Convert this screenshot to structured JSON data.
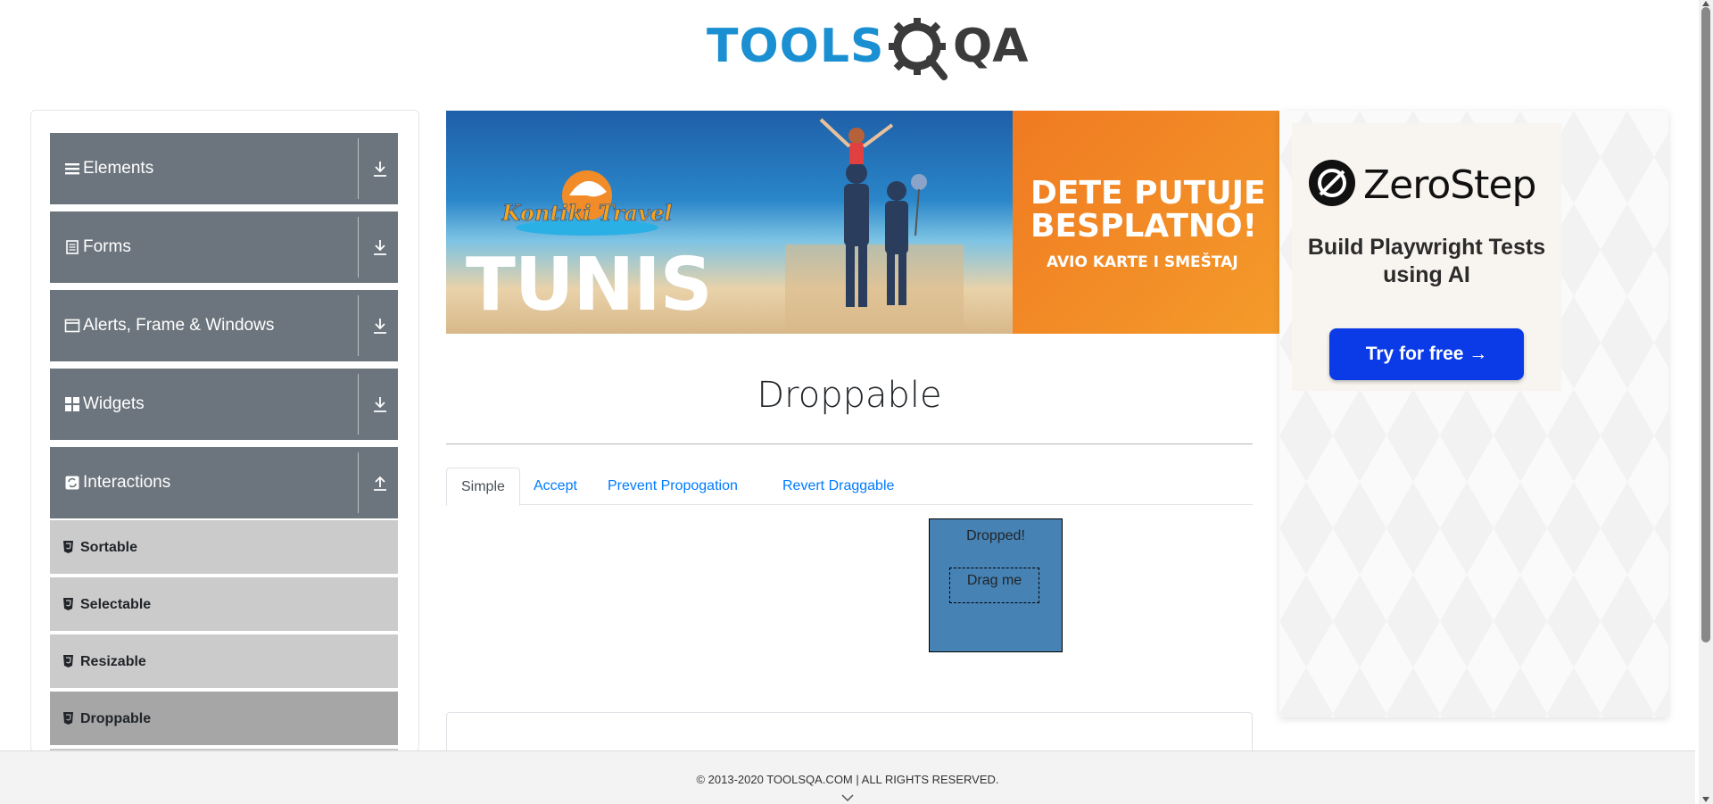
{
  "header": {
    "logo_text_tools": "TOOLS",
    "logo_text_qa": "QA"
  },
  "sidebar": {
    "groups": [
      {
        "label": "Elements",
        "icon": "list-icon",
        "expanded": false
      },
      {
        "label": "Forms",
        "icon": "document-icon",
        "expanded": false
      },
      {
        "label": "Alerts, Frame & Windows",
        "icon": "window-icon",
        "expanded": false
      },
      {
        "label": "Widgets",
        "icon": "grid-icon",
        "expanded": false
      },
      {
        "label": "Interactions",
        "icon": "interactions-icon",
        "expanded": true
      }
    ],
    "items": [
      {
        "label": "Sortable",
        "active": false
      },
      {
        "label": "Selectable",
        "active": false
      },
      {
        "label": "Resizable",
        "active": false
      },
      {
        "label": "Droppable",
        "active": true
      }
    ]
  },
  "banner": {
    "brand": "Kontiki Travel",
    "destination": "TUNIS",
    "headline": "DETE PUTUJE BESPLATNO!",
    "subline": "AVIO KARTE I SMEŠTAJ"
  },
  "main": {
    "title": "Droppable",
    "tabs": [
      {
        "label": "Simple",
        "active": true
      },
      {
        "label": "Accept",
        "active": false
      },
      {
        "label": "Prevent Propogation",
        "active": false
      },
      {
        "label": "Revert Draggable",
        "active": false
      }
    ],
    "droppable_text": "Dropped!",
    "draggable_text": "Drag me"
  },
  "right_ad": {
    "brand": "ZeroStep",
    "tagline": "Build Playwright Tests using AI",
    "button": "Try for free →"
  },
  "footer": {
    "text": "© 2013-2020 TOOLSQA.COM | ALL RIGHTS RESERVED."
  },
  "colors": {
    "sidebar_group": "#6c757d",
    "sidebar_item": "#cbcbcb",
    "sidebar_item_active": "#a6a6a6",
    "droppable": "#4682b4",
    "link": "#007bff",
    "cta": "#0a3be6"
  }
}
